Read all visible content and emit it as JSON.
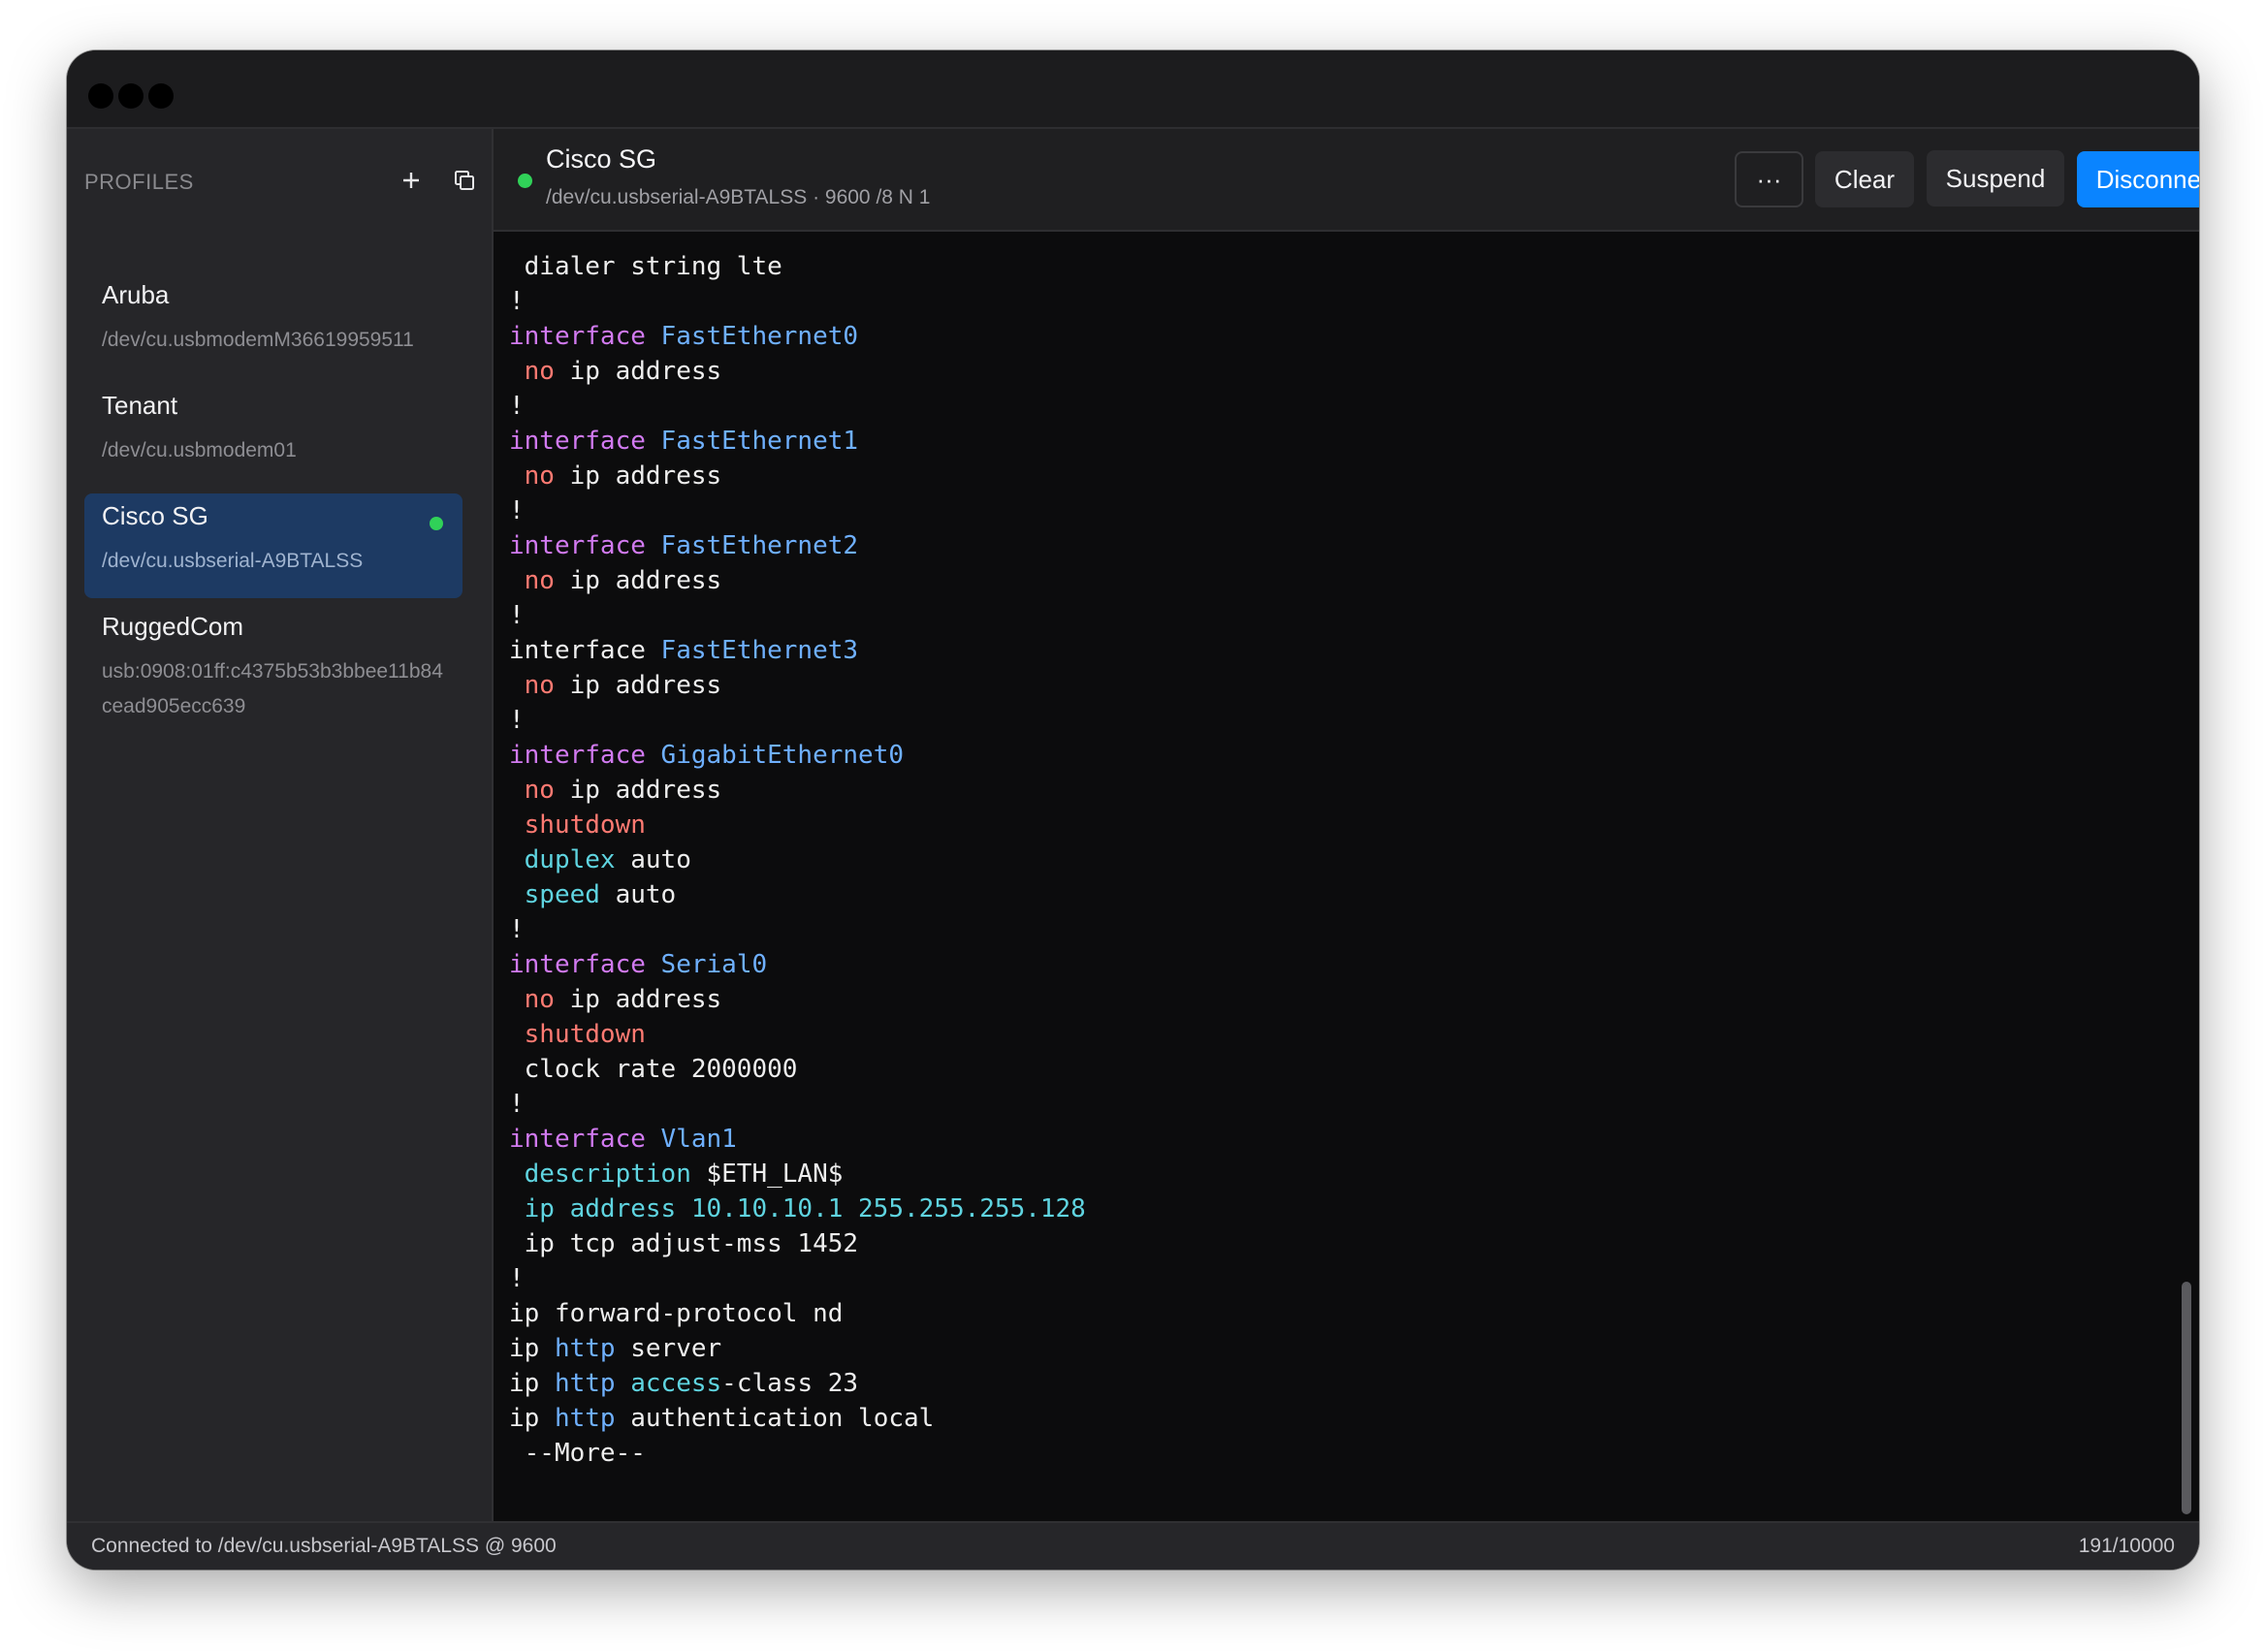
{
  "sidebar": {
    "title": "PROFILES",
    "icons": [
      "plus-icon",
      "duplicate-icon",
      "gear-icon"
    ],
    "profiles": [
      {
        "name": "Aruba",
        "path": "/dev/cu.usbmodemM36619959511",
        "active": false
      },
      {
        "name": "Tenant",
        "path": "/dev/cu.usbmodem01",
        "active": false
      },
      {
        "name": "Cisco SG",
        "path": "/dev/cu.usbserial-A9BTALSS",
        "active": true
      },
      {
        "name": "RuggedCom",
        "path": "usb:0908:01ff:c4375b53b3bbee11b84cead905ecc639",
        "active": false
      }
    ]
  },
  "header": {
    "title": "Cisco SG",
    "subtitle": "/dev/cu.usbserial-A9BTALSS · 9600 /8 N 1",
    "more_label": "···",
    "clear_label": "Clear",
    "suspend_label": "Suspend",
    "disconnect_label": "Disconnect"
  },
  "terminal": {
    "lines": [
      [
        {
          "t": " dialer string lte"
        }
      ],
      [
        {
          "t": "!"
        }
      ],
      [
        {
          "t": "interface ",
          "c": "purple"
        },
        {
          "t": "FastEthernet0",
          "c": "blue"
        }
      ],
      [
        {
          "t": " "
        },
        {
          "t": "no",
          "c": "red"
        },
        {
          "t": " ip address"
        }
      ],
      [
        {
          "t": "!"
        }
      ],
      [
        {
          "t": "interface ",
          "c": "purple"
        },
        {
          "t": "FastEthernet1",
          "c": "blue"
        }
      ],
      [
        {
          "t": " "
        },
        {
          "t": "no",
          "c": "red"
        },
        {
          "t": " ip address"
        }
      ],
      [
        {
          "t": "!"
        }
      ],
      [
        {
          "t": "interface ",
          "c": "purple"
        },
        {
          "t": "FastEthernet2",
          "c": "blue"
        }
      ],
      [
        {
          "t": " "
        },
        {
          "t": "no",
          "c": "red"
        },
        {
          "t": " ip address"
        }
      ],
      [
        {
          "t": "!"
        }
      ],
      [
        {
          "t": "interface "
        },
        {
          "t": "FastEthernet3",
          "c": "blue"
        }
      ],
      [
        {
          "t": " "
        },
        {
          "t": "no",
          "c": "red"
        },
        {
          "t": " ip address"
        }
      ],
      [
        {
          "t": "!"
        }
      ],
      [
        {
          "t": "interface ",
          "c": "purple"
        },
        {
          "t": "GigabitEthernet0",
          "c": "blue"
        }
      ],
      [
        {
          "t": " "
        },
        {
          "t": "no",
          "c": "red"
        },
        {
          "t": " ip address"
        }
      ],
      [
        {
          "t": " "
        },
        {
          "t": "shutdown",
          "c": "red"
        }
      ],
      [
        {
          "t": " "
        },
        {
          "t": "duplex",
          "c": "cyan"
        },
        {
          "t": " auto"
        }
      ],
      [
        {
          "t": " "
        },
        {
          "t": "speed",
          "c": "cyan"
        },
        {
          "t": " auto"
        }
      ],
      [
        {
          "t": "!"
        }
      ],
      [
        {
          "t": "interface ",
          "c": "purple"
        },
        {
          "t": "Serial0",
          "c": "blue"
        }
      ],
      [
        {
          "t": " "
        },
        {
          "t": "no",
          "c": "red"
        },
        {
          "t": " ip address"
        }
      ],
      [
        {
          "t": " "
        },
        {
          "t": "shutdown",
          "c": "red"
        }
      ],
      [
        {
          "t": " clock rate 2000000"
        }
      ],
      [
        {
          "t": "!"
        }
      ],
      [
        {
          "t": "interface ",
          "c": "purple"
        },
        {
          "t": "Vlan1",
          "c": "blue"
        }
      ],
      [
        {
          "t": " "
        },
        {
          "t": "description",
          "c": "cyan"
        },
        {
          "t": " $ETH_LAN$"
        }
      ],
      [
        {
          "t": " "
        },
        {
          "t": "ip address 10.10.10.1 255.255.255.128",
          "c": "cyan"
        }
      ],
      [
        {
          "t": " ip tcp adjust-mss 1452"
        }
      ],
      [
        {
          "t": "!"
        }
      ],
      [
        {
          "t": "ip forward-protocol nd"
        }
      ],
      [
        {
          "t": "ip "
        },
        {
          "t": "http",
          "c": "blue"
        },
        {
          "t": " server"
        }
      ],
      [
        {
          "t": "ip "
        },
        {
          "t": "http",
          "c": "blue"
        },
        {
          "t": " "
        },
        {
          "t": "access",
          "c": "cyan"
        },
        {
          "t": "-class 23"
        }
      ],
      [
        {
          "t": "ip "
        },
        {
          "t": "http",
          "c": "blue"
        },
        {
          "t": " authentication local"
        }
      ],
      [
        {
          "t": " --More--"
        }
      ]
    ]
  },
  "status": {
    "left": "Connected to /dev/cu.usbserial-A9BTALSS @ 9600",
    "right": "191/10000"
  },
  "colors": {
    "accent": "#0a84ff",
    "connected": "#30d158",
    "keyword_purple": "#d17af0",
    "keyword_blue": "#6fb0ff",
    "keyword_red": "#ff7a72",
    "keyword_cyan": "#5fd4e0"
  }
}
